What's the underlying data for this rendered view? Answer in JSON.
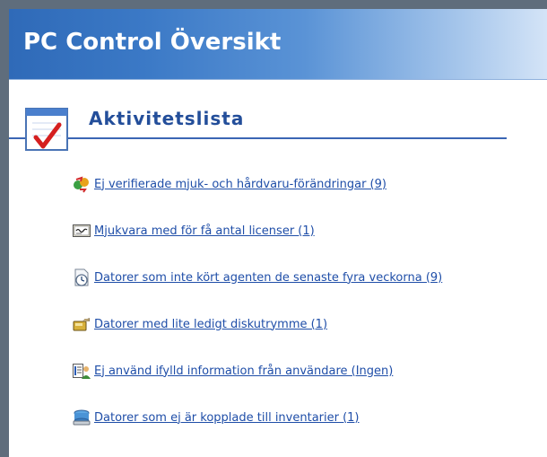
{
  "header": {
    "title": "PC Control Översikt"
  },
  "section": {
    "title": "Aktivitetslista"
  },
  "items": [
    {
      "label": "Ej verifierade mjuk- och hårdvaru-förändringar (9)",
      "icon": "change-verify-icon"
    },
    {
      "label": "Mjukvara med för få antal licenser (1)",
      "icon": "license-icon"
    },
    {
      "label": "Datorer som inte kört agenten de senaste fyra veckorna (9)",
      "icon": "agent-clock-icon"
    },
    {
      "label": "Datorer med lite ledigt diskutrymme (1)",
      "icon": "disk-space-icon"
    },
    {
      "label": "Ej använd ifylld information från användare (Ingen)",
      "icon": "user-info-icon"
    },
    {
      "label": "Datorer som ej är kopplade till inventarier (1)",
      "icon": "inventory-link-icon"
    }
  ],
  "colors": {
    "accent": "#2f6ab8",
    "link": "#1f4ea8",
    "section_title": "#234e9a"
  }
}
